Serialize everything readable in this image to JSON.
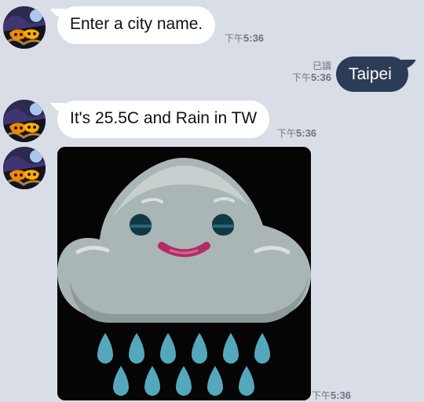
{
  "messages": [
    {
      "sender": "bot",
      "text": "Enter a city name.",
      "ampm": "下午",
      "time": "5:36"
    },
    {
      "sender": "user",
      "text": "Taipei",
      "read": "已讀",
      "ampm": "下午",
      "time": "5:36"
    },
    {
      "sender": "bot",
      "text": "It's 25.5C and Rain in TW",
      "ampm": "下午",
      "time": "5:36"
    },
    {
      "sender": "bot",
      "sticker": "rain-cloud-sticker",
      "ampm": "下午",
      "time": "5:36"
    }
  ],
  "colors": {
    "background": "#d9dde6",
    "incoming_bubble": "#ffffff",
    "outgoing_bubble": "#2c3b56",
    "meta_text": "#6f7580",
    "sticker_background": "#050505"
  },
  "icons": {
    "avatar": "halloween-pumpkin-avatar",
    "sticker": "rain-cloud-sticker"
  }
}
